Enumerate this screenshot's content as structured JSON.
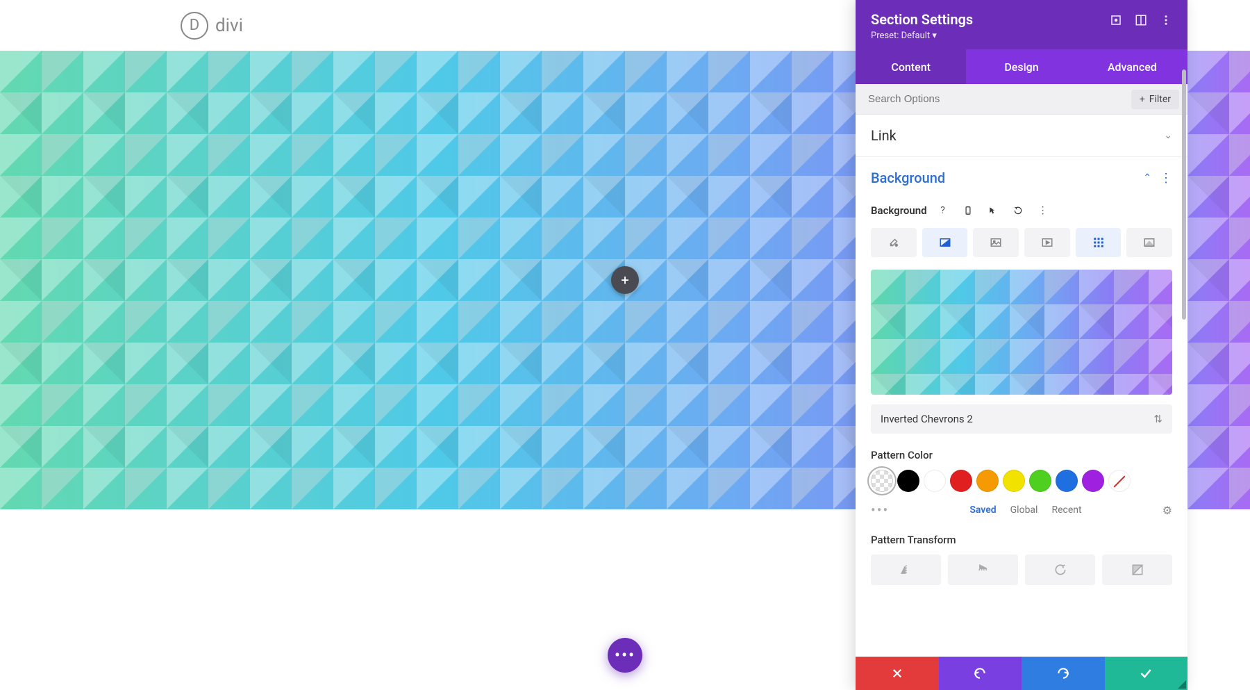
{
  "logo": {
    "letter": "D",
    "text": "divi"
  },
  "panel": {
    "title": "Section Settings",
    "preset": "Preset: Default ▾",
    "tabs": {
      "content": "Content",
      "design": "Design",
      "advanced": "Advanced"
    },
    "active_tab": "content",
    "search_placeholder": "Search Options",
    "filter_label": "Filter",
    "sections": {
      "link": "Link",
      "background": "Background"
    },
    "background": {
      "label": "Background",
      "pattern_select": "Inverted Chevrons 2",
      "pattern_color_label": "Pattern Color",
      "palette_tabs": {
        "saved": "Saved",
        "global": "Global",
        "recent": "Recent"
      },
      "pattern_transform_label": "Pattern Transform"
    },
    "swatches": [
      {
        "name": "checker",
        "color": null,
        "selected": true
      },
      {
        "name": "black",
        "color": "#000000"
      },
      {
        "name": "white",
        "color": "#ffffff"
      },
      {
        "name": "red",
        "color": "#e02020"
      },
      {
        "name": "orange",
        "color": "#f59a00"
      },
      {
        "name": "yellow",
        "color": "#f2e200"
      },
      {
        "name": "green",
        "color": "#4fcf20"
      },
      {
        "name": "blue",
        "color": "#1f6fe0"
      },
      {
        "name": "purple",
        "color": "#a020e0"
      },
      {
        "name": "none",
        "color": null
      }
    ]
  }
}
